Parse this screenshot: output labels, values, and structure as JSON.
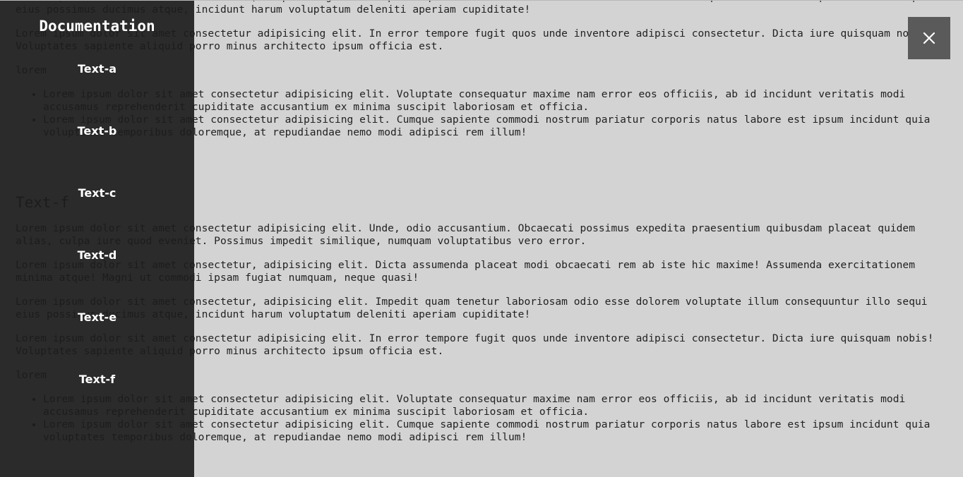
{
  "sidebar": {
    "title": "Documentation",
    "items": [
      {
        "label": "Text-a"
      },
      {
        "label": "Text-b"
      },
      {
        "label": "Text-c"
      },
      {
        "label": "Text-d"
      },
      {
        "label": "Text-e"
      },
      {
        "label": "Text-f"
      }
    ]
  },
  "close_button": {
    "icon": "close-icon"
  },
  "content": {
    "block1": {
      "p1": "Lorem ipsum dolor sit amet consectetur, adipisicing elit. Impedit quam tenetur laboriosam odio esse dolorem voluptate illum consequuntur illo sequi eius possimus ducimus atque, incidunt harum voluptatum deleniti aperiam cupiditate!",
      "p2": "Lorem ipsum dolor sit amet consectetur adipisicing elit. In error tempore fugit quos unde inventore adipisci consectetur. Dicta iure quisquam nobis! Voluptates sapiente aliquid porro minus architecto ipsum officia est.",
      "label": "lorem",
      "li1": "Lorem ipsum dolor sit amet consectetur adipisicing elit. Voluptate consequatur maxime nam error eos officiis, ab id incidunt veritatis modi accusamus reprehenderit cupiditate accusantium ex minima suscipit laboriosam et officia.",
      "li2": "Lorem ipsum dolor sit amet consectetur adipisicing elit. Cumque sapiente commodi nostrum pariatur corporis natus labore est ipsum incidunt quia voluptates temporibus doloremque, at repudiandae nemo modi adipisci rem illum!"
    },
    "section_title": "Text-f",
    "block2": {
      "p1": "Lorem ipsum dolor sit amet consectetur adipisicing elit. Unde, odio accusantium. Obcaecati possimus expedita praesentium quibusdam placeat quidem alias, culpa iure quod eveniet. Possimus impedit similique, numquam voluptatibus vero error.",
      "p2": "Lorem ipsum dolor sit amet consectetur, adipisicing elit. Dicta assumenda placeat modi obcaecati rem ab iste hic maxime! Assumenda exercitationem minima atque! Magni ut commodi ipsam fugiat numquam, neque quasi!",
      "p3": "Lorem ipsum dolor sit amet consectetur, adipisicing elit. Impedit quam tenetur laboriosam odio esse dolorem voluptate illum consequuntur illo sequi eius possimus ducimus atque, incidunt harum voluptatum deleniti aperiam cupiditate!",
      "p4": "Lorem ipsum dolor sit amet consectetur adipisicing elit. In error tempore fugit quos unde inventore adipisci consectetur. Dicta iure quisquam nobis! Voluptates sapiente aliquid porro minus architecto ipsum officia est.",
      "label": "lorem",
      "li1": "Lorem ipsum dolor sit amet consectetur adipisicing elit. Voluptate consequatur maxime nam error eos officiis, ab id incidunt veritatis modi accusamus reprehenderit cupiditate accusantium ex minima suscipit laboriosam et officia.",
      "li2": "Lorem ipsum dolor sit amet consectetur adipisicing elit. Cumque sapiente commodi nostrum pariatur corporis natus labore est ipsum incidunt quia voluptates temporibus doloremque, at repudiandae nemo modi adipisci rem illum!"
    }
  },
  "colors": {
    "page_background": "#d3d3d3",
    "sidebar_background": "#1c1c1c",
    "close_button_background": "#5a5a5a",
    "text": "#222222"
  }
}
